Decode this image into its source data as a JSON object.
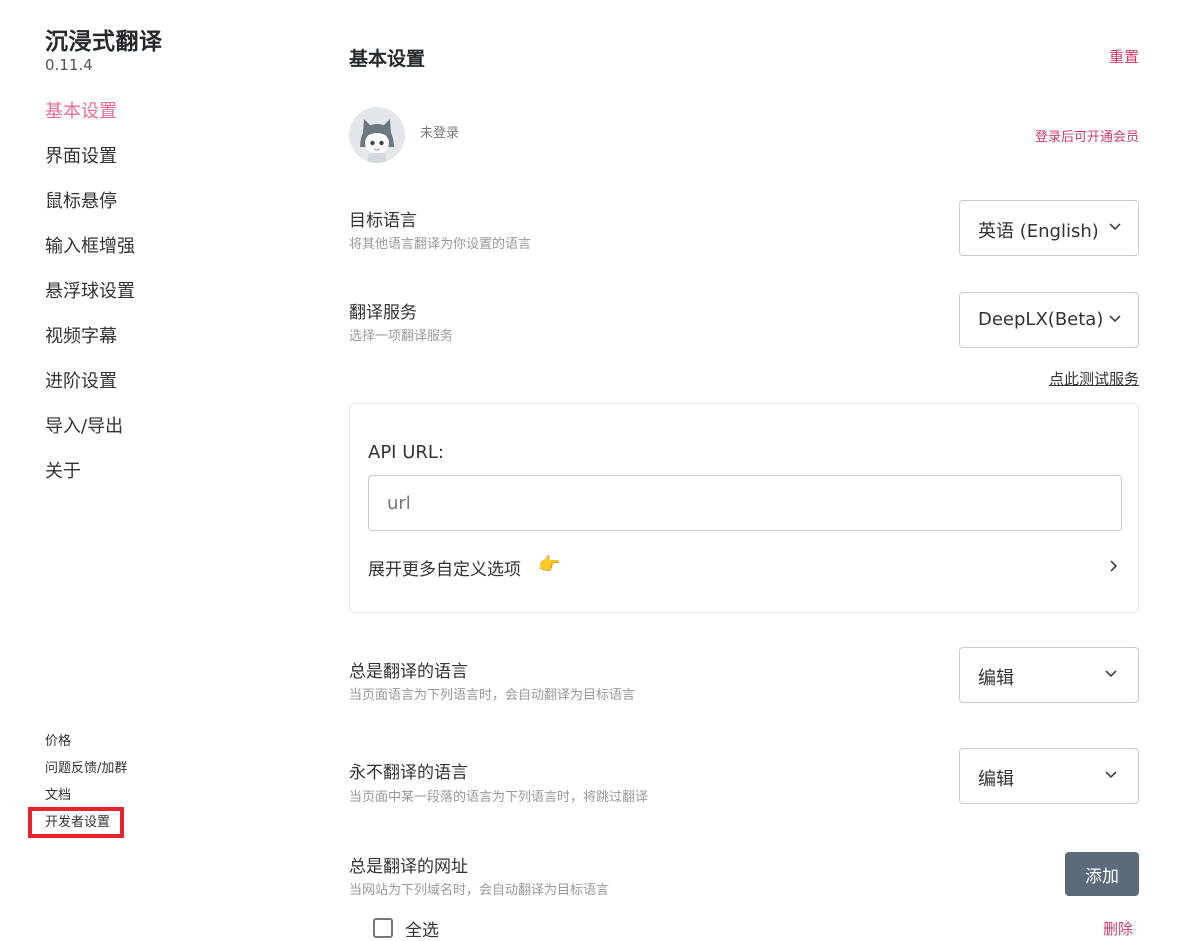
{
  "sidebar": {
    "app_name": "沉浸式翻译",
    "version": "0.11.4",
    "nav": [
      {
        "label": "基本设置",
        "active": true
      },
      {
        "label": "界面设置"
      },
      {
        "label": "鼠标悬停"
      },
      {
        "label": "输入框增强"
      },
      {
        "label": "悬浮球设置"
      },
      {
        "label": "视频字幕"
      },
      {
        "label": "进阶设置"
      },
      {
        "label": "导入/导出"
      },
      {
        "label": "关于"
      }
    ],
    "footer": [
      {
        "label": "价格"
      },
      {
        "label": "问题反馈/加群"
      },
      {
        "label": "文档"
      },
      {
        "label": "开发者设置",
        "highlighted": true
      }
    ]
  },
  "main": {
    "title": "基本设置",
    "reset_label": "重置",
    "login_status": "未登录",
    "member_label": "登录后可开通会员",
    "target_language": {
      "title": "目标语言",
      "desc": "将其他语言翻译为你设置的语言",
      "value": "英语 (English)"
    },
    "translation_service": {
      "title": "翻译服务",
      "desc": "选择一项翻译服务",
      "value": "DeepLX(Beta)"
    },
    "test_service_label": "点此测试服务",
    "api": {
      "label": "API URL:",
      "placeholder": "url",
      "value": "",
      "expand_label": "展开更多自定义选项"
    },
    "always_translate_languages": {
      "title": "总是翻译的语言",
      "desc": "当页面语言为下列语言时，会自动翻译为目标语言",
      "value": "编辑"
    },
    "never_translate_languages": {
      "title": "永不翻译的语言",
      "desc": "当页面中某一段落的语言为下列语言时，将跳过翻译",
      "value": "编辑"
    },
    "always_translate_sites": {
      "title": "总是翻译的网址",
      "desc": "当网站为下列域名时，会自动翻译为目标语言",
      "add_label": "添加",
      "select_all_label": "全选",
      "delete_label": "删除"
    }
  },
  "colors": {
    "accent": "#e86d8f",
    "link": "#cc3d6b",
    "button": "#5b6b79",
    "highlight": "#e8232c"
  },
  "icons": {
    "avatar": "cat-avatar",
    "dropdown": "chevron-down-icon",
    "expand": "chevron-right-icon",
    "pointing": "pointing-right-icon"
  }
}
